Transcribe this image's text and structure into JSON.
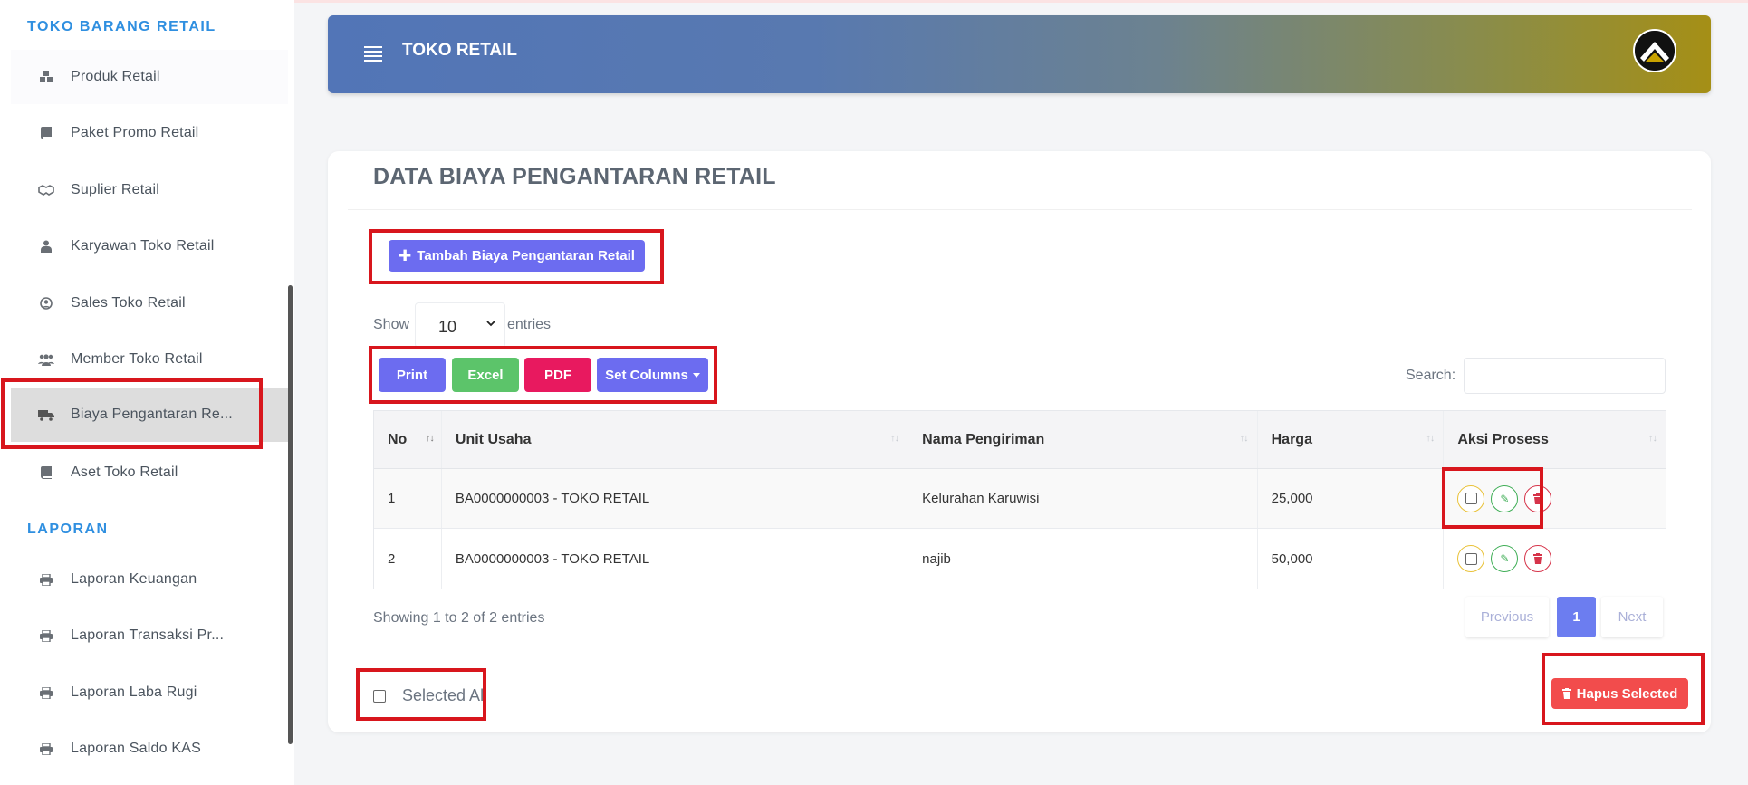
{
  "sidebar": {
    "section_toko": "TOKO BARANG RETAIL",
    "items_toko": [
      {
        "label": "Produk Retail",
        "icon": "cubes-icon"
      },
      {
        "label": "Paket Promo Retail",
        "icon": "book-icon"
      },
      {
        "label": "Suplier Retail",
        "icon": "handshake-icon"
      },
      {
        "label": "Karyawan Toko Retail",
        "icon": "user-tie-icon"
      },
      {
        "label": "Sales Toko Retail",
        "icon": "user-circle-icon"
      },
      {
        "label": "Member Toko Retail",
        "icon": "users-icon"
      },
      {
        "label": "Biaya Pengantaran Re...",
        "icon": "truck-icon"
      },
      {
        "label": "Aset Toko Retail",
        "icon": "book-icon"
      }
    ],
    "section_laporan": "LAPORAN",
    "items_laporan": [
      {
        "label": "Laporan Keuangan",
        "icon": "print-icon"
      },
      {
        "label": "Laporan Transaksi Pr...",
        "icon": "print-icon"
      },
      {
        "label": "Laporan Laba Rugi",
        "icon": "print-icon"
      },
      {
        "label": "Laporan Saldo KAS",
        "icon": "print-icon"
      }
    ]
  },
  "header": {
    "title": "TOKO RETAIL"
  },
  "card": {
    "title": "DATA BIAYA PENGANTARAN RETAIL",
    "add_button": "Tambah Biaya Pengantaran Retail",
    "show_label": "Show",
    "entries_value": "10",
    "entries_label": "entries",
    "buttons": {
      "print": "Print",
      "excel": "Excel",
      "pdf": "PDF",
      "set_columns": "Set Columns"
    },
    "search_label": "Search:",
    "table": {
      "headers": [
        "No",
        "Unit Usaha",
        "Nama Pengiriman",
        "Harga",
        "Aksi Prosess"
      ],
      "rows": [
        {
          "no": "1",
          "unit": "BA0000000003 - TOKO RETAIL",
          "nama": "Kelurahan Karuwisi",
          "harga": "25,000"
        },
        {
          "no": "2",
          "unit": "BA0000000003 - TOKO RETAIL",
          "nama": "najib",
          "harga": "50,000"
        }
      ]
    },
    "info": "Showing 1 to 2 of 2 entries",
    "pagination": {
      "previous": "Previous",
      "current": "1",
      "next": "Next"
    },
    "selected_all": "Selected All",
    "hapus_button": "Hapus Selected"
  },
  "colors": {
    "accent": "#6c6cf0",
    "excel": "#5cc46a",
    "pdf": "#e8195f",
    "danger": "#f24c4c",
    "highlight_box": "#d8161d",
    "section_title": "#2f8fe0"
  }
}
